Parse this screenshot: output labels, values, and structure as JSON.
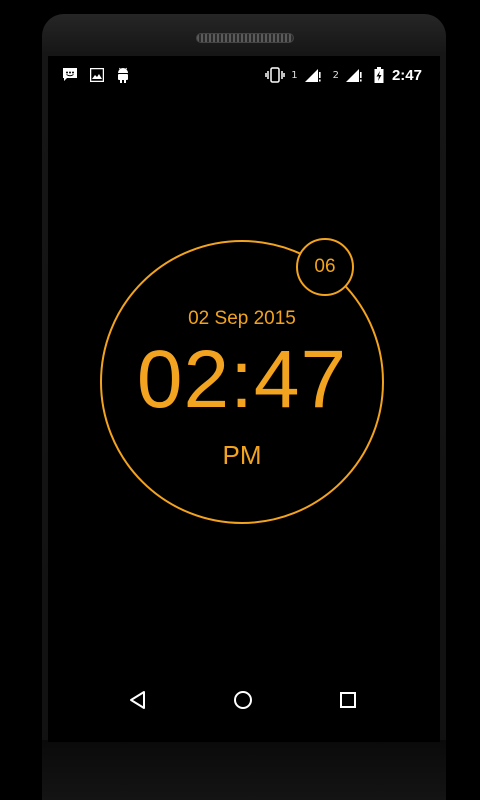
{
  "status_bar": {
    "notification_icons": [
      "message-icon",
      "image-icon",
      "android-icon"
    ],
    "vibrate_icon": "vibrate-icon",
    "sim1_label": "1",
    "sim2_label": "2",
    "signal_icon": "signal-icon",
    "battery_icon": "battery-charging-icon",
    "time": "2:47"
  },
  "clock": {
    "date": "02 Sep 2015",
    "time": "02:47",
    "ampm": "PM",
    "seconds": "06",
    "accent_color": "#f2a31f"
  },
  "nav_bar": {
    "back_icon": "back-triangle-icon",
    "home_icon": "home-circle-icon",
    "recents_icon": "recents-square-icon"
  }
}
